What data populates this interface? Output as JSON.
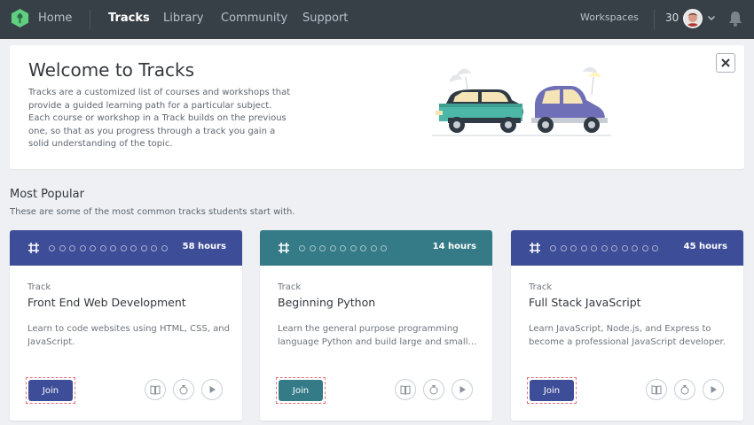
{
  "nav": {
    "items": [
      "Home",
      "Tracks",
      "Library",
      "Community",
      "Support"
    ],
    "active": "Tracks",
    "workspaces": "Workspaces",
    "points": "30"
  },
  "welcome": {
    "title": "Welcome to Tracks",
    "body": "Tracks are a customized list of courses and workshops that provide a guided learning path for a particular subject. Each course or workshop in a Track builds on the previous one, so that as you progress through a track you gain a solid understanding of the topic.",
    "close_label": "×"
  },
  "section": {
    "title": "Most Popular",
    "subtitle": "These are some of the most common tracks students start with."
  },
  "cards": [
    {
      "hours": "58 hours",
      "label": "Track",
      "title": "Front End Web Development",
      "description": "Learn to code websites using HTML, CSS, and JavaScript.",
      "join": "Join",
      "color": "#3d4d98",
      "button_color": "#3d4d98",
      "dots": 12
    },
    {
      "hours": "14 hours",
      "label": "Track",
      "title": "Beginning Python",
      "description": "Learn the general purpose programming language Python and build large and small…",
      "join": "Join",
      "color": "#347b87",
      "button_color": "#347b87",
      "dots": 9
    },
    {
      "hours": "45 hours",
      "label": "Track",
      "title": "Full Stack JavaScript",
      "description": "Learn JavaScript, Node.js, and Express to become a professional JavaScript developer.",
      "join": "Join",
      "color": "#3d4d98",
      "button_color": "#3d4d98",
      "dots": 11
    }
  ],
  "icons": {
    "logo": "treehouse-logo-icon",
    "notifications": "bell-icon",
    "menu": "chevron-down-icon",
    "track": "track-grid-icon",
    "book": "book-icon",
    "badge": "badge-icon",
    "play": "play-icon"
  }
}
